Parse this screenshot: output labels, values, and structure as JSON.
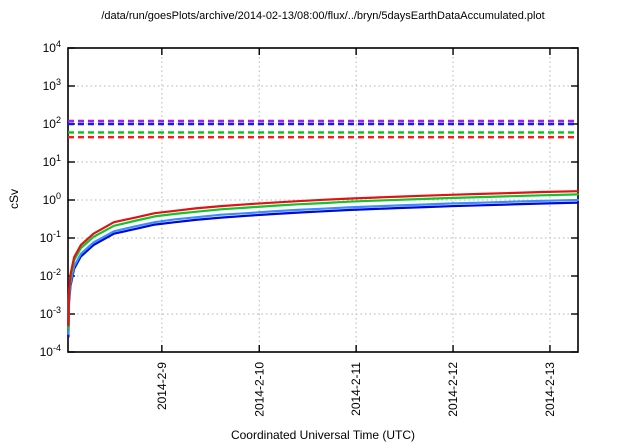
{
  "page": {
    "background": "#ffffff"
  },
  "chart_data": {
    "type": "line",
    "title": "/data/run/goesPlots/archive/2014-02-13/08:00/flux/../bryn/5daysEarthDataAccumulated.plot",
    "xlabel": "Coordinated Universal Time (UTC)",
    "ylabel": "cSv",
    "y_scale": "log",
    "y_exp_range": [
      -4,
      4
    ],
    "y_tick_exponents": [
      4,
      3,
      2,
      1,
      0,
      -1,
      -2,
      -3,
      -4
    ],
    "x_ticks": [
      {
        "label": "2014-2-9",
        "frac": 0.184
      },
      {
        "label": "2014-2-10",
        "frac": 0.375
      },
      {
        "label": "2014-2-11",
        "frac": 0.565
      },
      {
        "label": "2014-2-12",
        "frac": 0.755
      },
      {
        "label": "2014-2-13",
        "frac": 0.945
      }
    ],
    "grid": true,
    "legend": "none",
    "colors": {
      "axis": "#000000",
      "grid": "#b5b5b5"
    },
    "thresholds": [
      {
        "name": "limit-line-purple",
        "value": 120,
        "color": "#a020f0",
        "style": "dashed"
      },
      {
        "name": "limit-line-blue",
        "value": 100,
        "color": "#1616ff",
        "style": "dashed"
      },
      {
        "name": "limit-line-green",
        "value": 60,
        "color": "#00c812",
        "style": "dashed"
      },
      {
        "name": "limit-line-red",
        "value": 45,
        "color": "#ff1a1a",
        "style": "dashed"
      }
    ],
    "x_frac": [
      0.0008,
      0.002,
      0.005,
      0.012,
      0.025,
      0.05,
      0.09,
      0.13,
      0.17,
      0.21,
      0.25,
      0.3,
      0.35,
      0.4,
      0.45,
      0.5,
      0.55,
      0.6,
      0.65,
      0.7,
      0.75,
      0.81,
      0.87,
      0.93,
      1.0
    ],
    "series": [
      {
        "name": "accumulated-dose-red",
        "color": "#e11212",
        "values": [
          0.0005,
          0.004,
          0.011,
          0.031,
          0.065,
          0.13,
          0.26,
          0.34,
          0.45,
          0.52,
          0.6,
          0.69,
          0.77,
          0.85,
          0.93,
          1.01,
          1.09,
          1.16,
          1.23,
          1.3,
          1.37,
          1.45,
          1.53,
          1.62,
          1.7
        ]
      },
      {
        "name": "accumulated-dose-green",
        "color": "#0fc42c",
        "values": [
          0.0004,
          0.0033,
          0.0091,
          0.026,
          0.054,
          0.107,
          0.21,
          0.28,
          0.37,
          0.43,
          0.49,
          0.57,
          0.63,
          0.7,
          0.77,
          0.83,
          0.9,
          0.96,
          1.01,
          1.07,
          1.13,
          1.19,
          1.26,
          1.33,
          1.4
        ]
      },
      {
        "name": "accumulated-dose-lightblue",
        "color": "#3b8dff",
        "values": [
          0.0003,
          0.0024,
          0.0065,
          0.018,
          0.038,
          0.076,
          0.15,
          0.2,
          0.26,
          0.31,
          0.35,
          0.41,
          0.45,
          0.5,
          0.55,
          0.59,
          0.64,
          0.68,
          0.72,
          0.76,
          0.81,
          0.85,
          0.9,
          0.95,
          1.0
        ]
      },
      {
        "name": "accumulated-dose-darkblue",
        "color": "#0008d8",
        "values": [
          0.00025,
          0.002,
          0.0055,
          0.0155,
          0.0325,
          0.065,
          0.13,
          0.17,
          0.225,
          0.26,
          0.3,
          0.345,
          0.385,
          0.425,
          0.465,
          0.505,
          0.545,
          0.58,
          0.615,
          0.65,
          0.685,
          0.725,
          0.765,
          0.81,
          0.85
        ]
      }
    ]
  }
}
